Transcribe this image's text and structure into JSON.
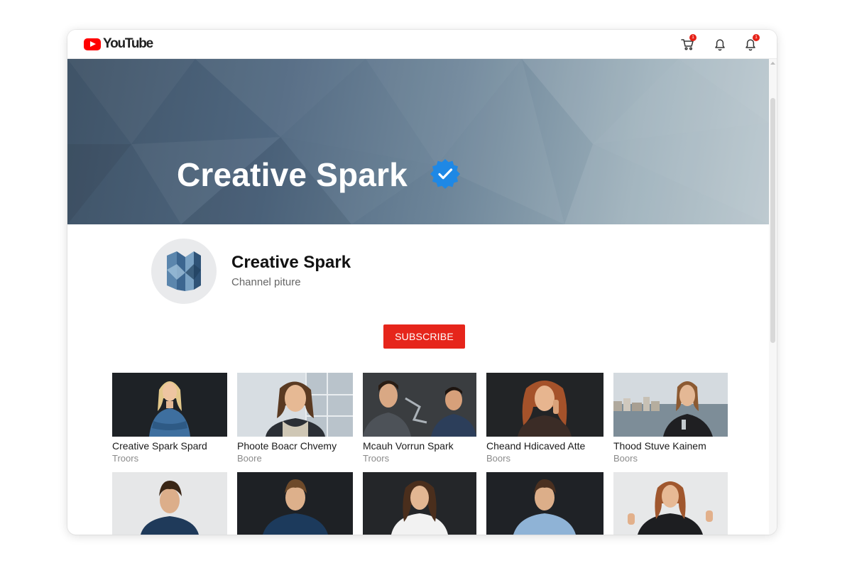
{
  "app": {
    "logo_text": "YouTube"
  },
  "header_icons": [
    {
      "name": "cart-icon",
      "badge": "1"
    },
    {
      "name": "bell-icon",
      "badge": ""
    },
    {
      "name": "account-bell-icon",
      "badge": "1"
    }
  ],
  "banner": {
    "title": "Creative Spark",
    "verified_icon": "verified-check-icon"
  },
  "channel": {
    "name": "Creative Spark",
    "subtitle": "Channel piture"
  },
  "subscribe": {
    "label": "SUBSCRIBE"
  },
  "colors": {
    "accent": "#e6251b",
    "verified": "#1e88e5",
    "banner_dark": "#3f5367",
    "banner_light": "#b6c4cb"
  },
  "videos_row1": [
    {
      "title": "Creative Spark Spard",
      "meta": "Troors"
    },
    {
      "title": "Phoote Boacr Chvemy",
      "meta": "Boore"
    },
    {
      "title": "Mcauh Vorrun Spark",
      "meta": "Troors"
    },
    {
      "title": "Cheand Hdicaved Atte",
      "meta": "Boors"
    },
    {
      "title": "Thood Stuve Kainem",
      "meta": "Boors"
    }
  ],
  "videos_row2": [
    {
      "title": "",
      "meta": ""
    },
    {
      "title": "",
      "meta": ""
    },
    {
      "title": "",
      "meta": ""
    },
    {
      "title": "",
      "meta": ""
    },
    {
      "title": "",
      "meta": ""
    }
  ]
}
